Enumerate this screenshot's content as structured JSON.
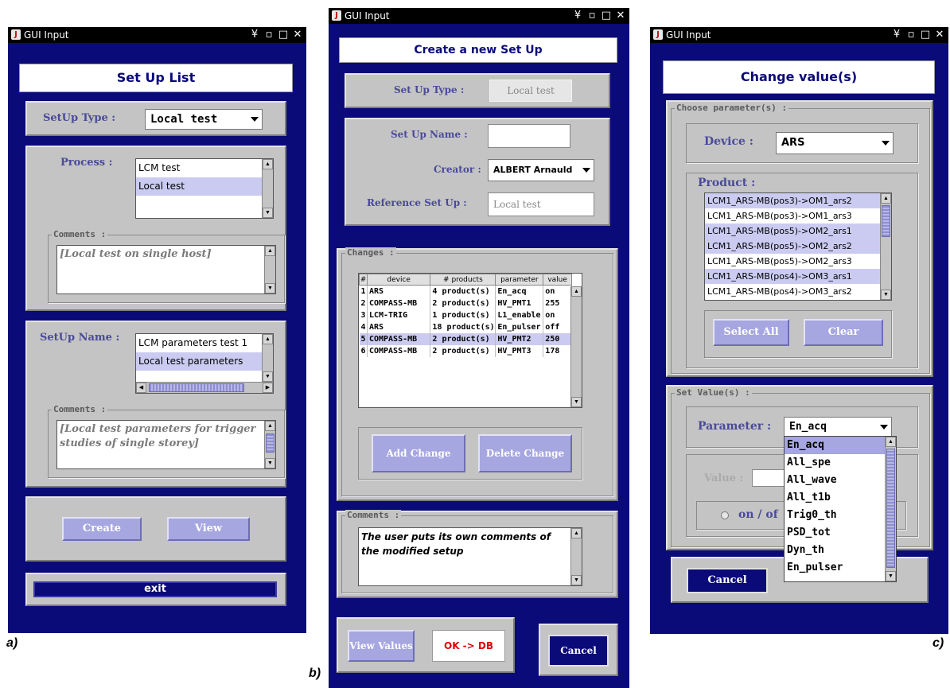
{
  "window_title": "GUI Input",
  "titlebar_buttons": [
    "¥",
    "▫",
    "□",
    "✕"
  ],
  "captions": {
    "a": "a)",
    "b": "b)",
    "c": "c)"
  },
  "panel_a": {
    "header": "Set Up List",
    "setup_type_label": "SetUp Type :",
    "setup_type_value": "Local test",
    "process_label": "Process :",
    "process_items": [
      "LCM test",
      "Local test"
    ],
    "comments_title": "Comments :",
    "process_comment": "[Local test on single host]",
    "setup_name_label": "SetUp Name :",
    "setup_name_items": [
      "LCM parameters test 1",
      "Local test parameters"
    ],
    "setup_comment": "[Local test parameters for trigger studies of single storey]",
    "create_label": "Create",
    "view_label": "View",
    "exit_label": "exit"
  },
  "panel_b": {
    "header": "Create a new Set Up",
    "setup_type_label": "Set Up Type :",
    "setup_type_value": "Local test",
    "setup_name_label": "Set Up Name :",
    "setup_name_value": "",
    "creator_label": "Creator :",
    "creator_value": "ALBERT Arnauld",
    "reference_label": "Reference Set Up :",
    "reference_value": "Local test",
    "changes_title": "Changes :",
    "table_headers": [
      "#",
      "device",
      "# products",
      "parameter",
      "value"
    ],
    "table_rows": [
      [
        "1",
        "ARS",
        "4 product(s)",
        "En_acq",
        "on"
      ],
      [
        "2",
        "COMPASS-MB",
        "2 product(s)",
        "HV_PMT1",
        "255"
      ],
      [
        "3",
        "LCM-TRIG",
        "1 product(s)",
        "L1_enable",
        "on"
      ],
      [
        "4",
        "ARS",
        "18 product(s)",
        "En_pulser",
        "off"
      ],
      [
        "5",
        "COMPASS-MB",
        "2 product(s)",
        "HV_PMT2",
        "250"
      ],
      [
        "6",
        "COMPASS-MB",
        "2 product(s)",
        "HV_PMT3",
        "178"
      ]
    ],
    "add_change_label": "Add Change",
    "delete_change_label": "Delete Change",
    "comments_title": "Comments :",
    "comment_text": "The user puts its own comments of the modified setup",
    "view_values_label": "View Values",
    "ok_label": "OK -> DB",
    "cancel_label": "Cancel"
  },
  "panel_c": {
    "header": "Change value(s)",
    "choose_title": "Choose parameter(s) :",
    "device_label": "Device :",
    "device_value": "ARS",
    "product_label": "Product :",
    "product_items": [
      "LCM1_ARS-MB(pos3)->OM1_ars2",
      "LCM1_ARS-MB(pos3)->OM1_ars3",
      "LCM1_ARS-MB(pos5)->OM2_ars1",
      "LCM1_ARS-MB(pos5)->OM2_ars2",
      "LCM1_ARS-MB(pos5)->OM2_ars3",
      "LCM1_ARS-MB(pos4)->OM3_ars1",
      "LCM1_ARS-MB(pos4)->OM3_ars2"
    ],
    "select_all_label": "Select All",
    "clear_label": "Clear",
    "set_values_title": "Set Value(s) :",
    "parameter_label": "Parameter :",
    "parameter_value": "En_acq",
    "parameter_options": [
      "En_acq",
      "All_spe",
      "All_wave",
      "All_t1b",
      "Trig0_th",
      "PSD_tot",
      "Dyn_th",
      "En_pulser"
    ],
    "value_label": "Value :",
    "onoff_label": "on / of",
    "cancel_label": "Cancel"
  }
}
